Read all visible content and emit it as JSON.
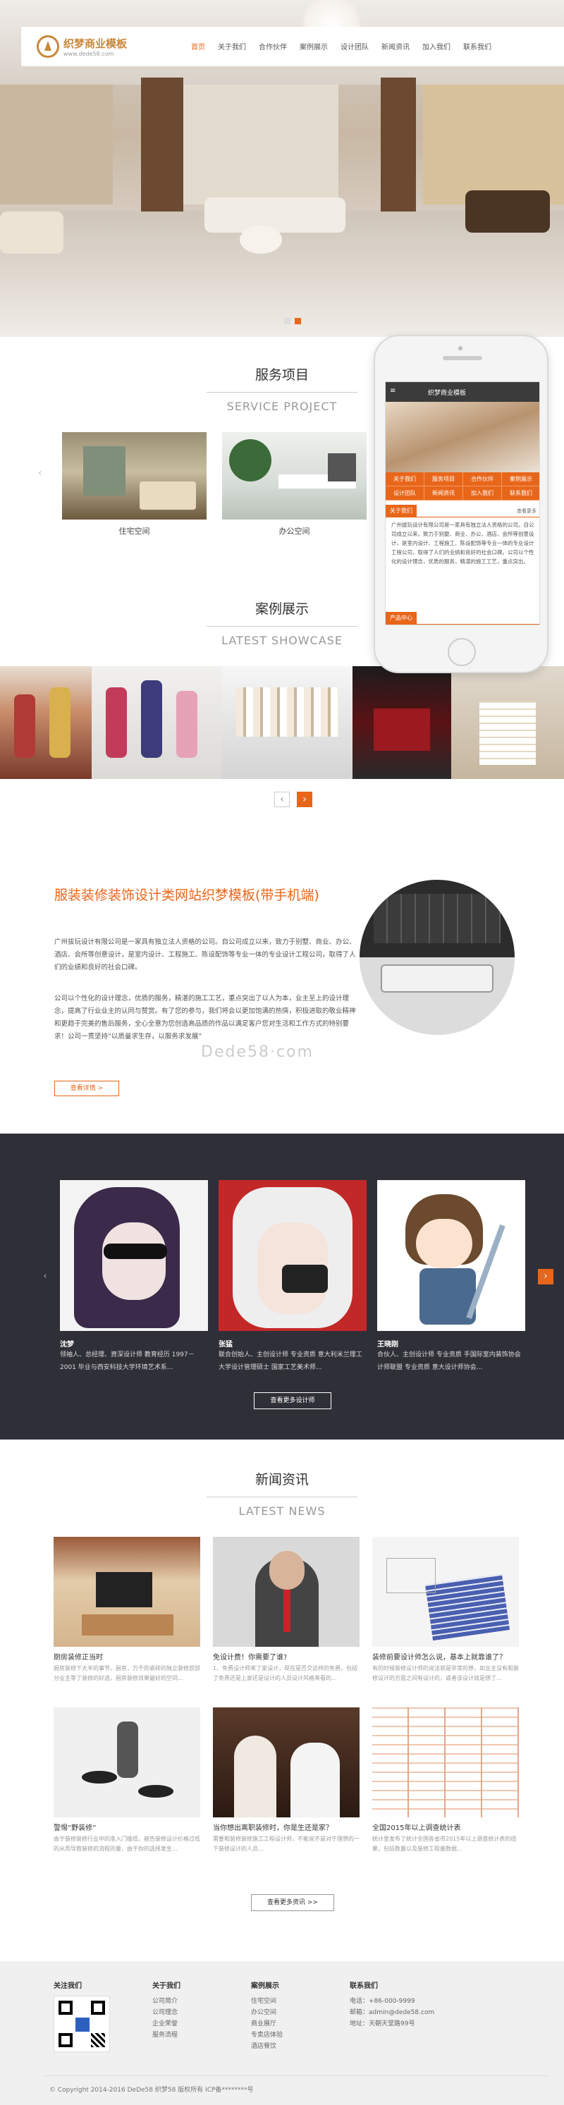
{
  "header": {
    "logo_title": "织梦商业模板",
    "logo_sub": "www.dede58.com",
    "nav": [
      "首页",
      "关于我们",
      "合作伙伴",
      "案例展示",
      "设计团队",
      "新闻资讯",
      "加入我们",
      "联系我们"
    ]
  },
  "services": {
    "title": "服务项目",
    "subtitle": "SERVICE PROJECT",
    "items": [
      {
        "label": "住宅空间"
      },
      {
        "label": "办公空间"
      }
    ]
  },
  "phone": {
    "logo": "织梦商业模板",
    "nav": [
      "关于我们",
      "服务项目",
      "合作伙伴",
      "案例展示",
      "设计团队",
      "新闻资讯",
      "加入我们",
      "联系我们"
    ],
    "about_head": "关于我们",
    "more": "查看更多",
    "about_text": "广州拔玩设计有限公司是一家具有独立法人资格的公司。自公司成立以来，致力于别墅、商业、办公、酒店、会所等创意设计，是室内设计、工程施工、陈设配饰等专业一体的专业设计工程公司，取得了人们的业绩和良好的社会口碑。公司以个性化的设计理念，优质的服务，精湛的施工工艺，重点突出。",
    "product_head": "产品中心"
  },
  "showcase": {
    "title": "案例展示",
    "subtitle": "LATEST SHOWCASE",
    "prev": "‹",
    "next": "›"
  },
  "about": {
    "title": "服装装修装饰设计类网站织梦模板(带手机端)",
    "p1": "广州拔玩设计有限公司是一家具有独立法人资格的公司。自公司成立以来，致力于别墅、商业、办公、酒店、会所等创意设计，是室内设计、工程施工、陈设配饰等专业一体的专业设计工程公司，取得了人们的业绩和良好的社会口碑。",
    "p2": "公司以个性化的设计理念，优质的服务，精湛的施工工艺，重点突出了以人为本，业主至上的设计理念，提高了行业业主的认同与赞赏。有了您的参与，我们将会以更加饱满的热情，积极进取的敬业精神和更趋于完美的售后服务，全心全意为您创造高品质的作品以满足客户您对生活和工作方式的特别要求！公司一贯坚持“以质量求生存，以服务求发展”",
    "button": "查看详情 >",
    "watermark": "Dede58·com"
  },
  "team": {
    "members": [
      {
        "name": "沈梦",
        "desc": "领袖人、总经理、資深设计师 教育经历 1997－2001 毕业与西安科技大学环境艺术系..."
      },
      {
        "name": "张猛",
        "desc": "联合创始人、主创设计师 专业资质 意大利米兰理工大学设计管理硕士 国家工艺美术师..."
      },
      {
        "name": "王晓刚",
        "desc": "合伙人、主创设计师 专业资质 手国际室内装饰协会 计师联盟 专业资质 意大设计师协会..."
      }
    ],
    "prev": "‹",
    "next": "›",
    "button": "查看更多设计师"
  },
  "news": {
    "title": "新闻资讯",
    "subtitle": "LATEST NEWS",
    "items": [
      {
        "title": "厨房装修正当时",
        "desc": "厨房装修下大半的事节，厨房，万千的瓷砖的独立装修部部分业主等了装修的好选，厨房装修效果最好的空间..."
      },
      {
        "title": "免设计费！你需要了谁?",
        "desc": "1、免费设计师来了家设计，现在是否交这样的免费，包括了免费还是上家还是设计的人员设计风格来看的..."
      },
      {
        "title": "装修前要设计师怎么说，基本上就靠谁了？",
        "desc": "有的时候装修设计师的说法就是非常的想，如业主没有和装修设计的方面之间有设计的，或者该设计就是想了..."
      },
      {
        "title": "警惕“野装修”",
        "desc": "由于装修装修行业中的准入门槛低，被告装修设计价格过低的从而导致装修的流程的量，由于你的选择发生..."
      },
      {
        "title": "当你想出离职装修时，你是生还是家？",
        "desc": "需要和装修装修施工工程设计师，不能说不是对于理想的一下装修设计的人员..."
      },
      {
        "title": "全国2015年以上调查统计表",
        "desc": "统计里发布了统计全国各省市2015年以上调查统计表的结果，包括数量以及装修工程量数据..."
      }
    ],
    "button": "查看更多资讯 >>"
  },
  "footer": {
    "follow": "关注我们",
    "about_head": "关于我们",
    "about_links": [
      "公司简介",
      "公司理念",
      "企业荣誉",
      "服务流程"
    ],
    "case_head": "案例展示",
    "case_links": [
      "住宅空间",
      "办公空间",
      "商业展厅",
      "专卖店体验",
      "酒店餐饮"
    ],
    "contact_head": "联系我们",
    "contact": [
      "电话：+86-000-9999",
      "邮箱：admin@dede58.com",
      "地址：天朝天堂路99号"
    ],
    "copyright": "© Copyright 2014-2016 DeDe58 织梦58 版权所有    ICP备********号"
  }
}
